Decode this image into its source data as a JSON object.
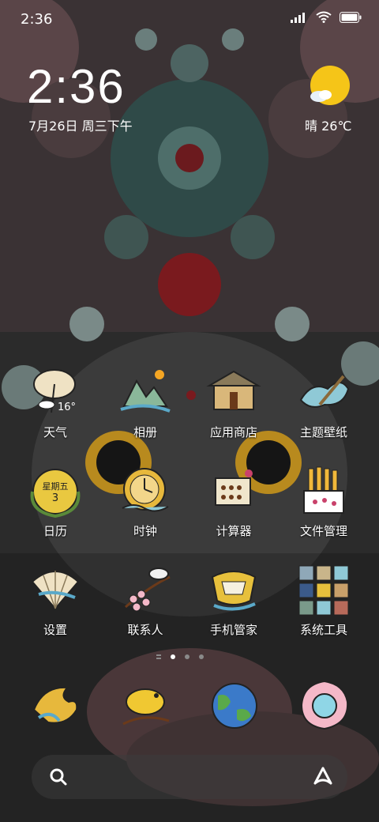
{
  "status_bar": {
    "time": "2:36",
    "icons": [
      "signal-icon",
      "wifi-icon",
      "battery-icon"
    ]
  },
  "widget": {
    "clock": "2:36",
    "date": "7月26日 周三下午",
    "weather": "晴 26℃"
  },
  "apps": [
    {
      "name": "天气",
      "icon": "weather-icon",
      "badge": "16°"
    },
    {
      "name": "相册",
      "icon": "gallery-icon"
    },
    {
      "name": "应用商店",
      "icon": "app-store-icon"
    },
    {
      "name": "主题壁纸",
      "icon": "themes-icon"
    },
    {
      "name": "日历",
      "icon": "calendar-icon",
      "badge_line1": "星期五",
      "badge_line2": "3"
    },
    {
      "name": "时钟",
      "icon": "clock-icon"
    },
    {
      "name": "计算器",
      "icon": "calculator-icon"
    },
    {
      "name": "文件管理",
      "icon": "file-manager-icon"
    },
    {
      "name": "设置",
      "icon": "settings-icon"
    },
    {
      "name": "联系人",
      "icon": "contacts-icon"
    },
    {
      "name": "手机管家",
      "icon": "phone-manager-icon"
    },
    {
      "name": "系统工具",
      "icon": "system-tools-folder-icon"
    }
  ],
  "page_indicator": {
    "pages": 3,
    "active": 1
  },
  "dock": [
    "phone-icon",
    "messages-icon",
    "browser-icon",
    "camera-icon"
  ],
  "colors": {
    "sun": "#f5c518",
    "label": "#ffffff",
    "wallpaper_dark": "#2b2b2b"
  }
}
